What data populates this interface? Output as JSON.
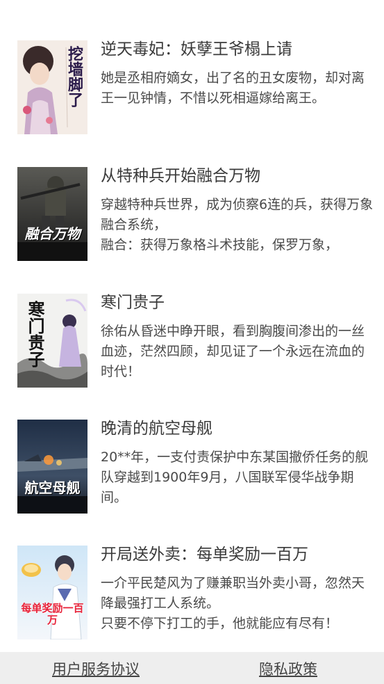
{
  "books": [
    {
      "title": "逆天毒妃：妖孽王爷榻上请",
      "desc": [
        "她是丞相府嫡女，出了名的丑女废物，却对离王一见钟情，不惜以死相逼嫁给离王。"
      ],
      "cover_text": "挖墙脚了"
    },
    {
      "title": "从特种兵开始融合万物",
      "desc": [
        "穿越特种兵世界，成为侦察6连的兵，获得万象融合系统，",
        "融合：获得万象格斗术技能，保罗万象，"
      ],
      "cover_text": "融合万物"
    },
    {
      "title": "寒门贵子",
      "desc": [
        "徐佑从昏迷中睁开眼，看到胸腹间渗出的一丝血迹，茫然四顾，却见证了一个永远在流血的时代！"
      ],
      "cover_text": "寒门贵子"
    },
    {
      "title": "晚清的航空母舰",
      "desc": [
        "20**年，一支付责保护中东某国撤侨任务的舰队穿越到1900年9月，八国联军侵华战争期间。"
      ],
      "cover_text": "航空母舰"
    },
    {
      "title": "开局送外卖：每单奖励一百万",
      "desc": [
        "一介平民楚风为了赚兼职当外卖小哥，忽然天降最强打工人系统。",
        "只要不停下打工的手，他就能应有尽有！"
      ],
      "cover_text": "每单奖励一百万"
    }
  ],
  "footer": {
    "terms_label": "用户服务协议",
    "privacy_label": "隐私政策"
  }
}
